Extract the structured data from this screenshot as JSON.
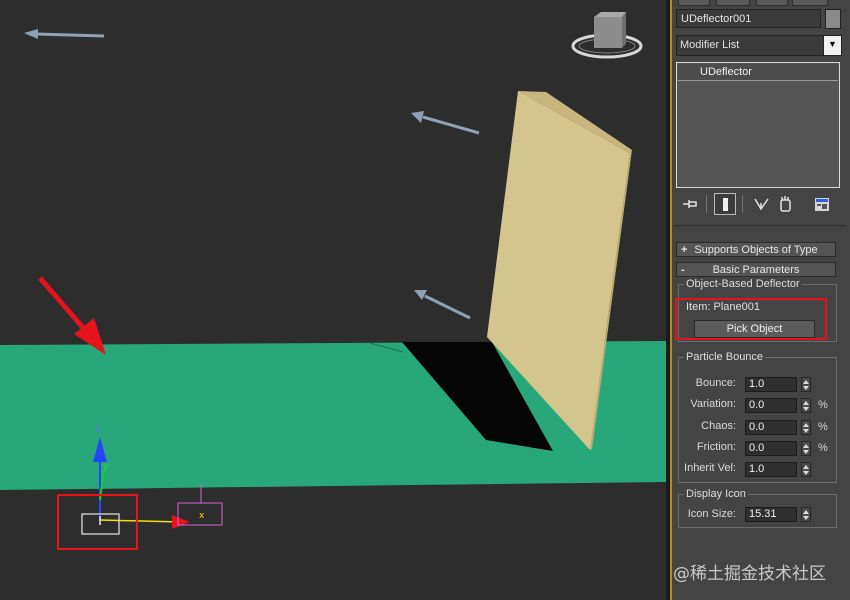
{
  "viewport": {
    "axis_labels": {
      "z": "z",
      "y": "y",
      "x": "x"
    },
    "colors": {
      "background": "#2d2d2d",
      "plane": "#27a77a",
      "box": "#d4c58f",
      "arrow_annotation": "#e4131c",
      "highlight": "#e4131c"
    },
    "objects": [
      "deflector-plane",
      "box-wall",
      "particle-arrow",
      "particle-arrow",
      "particle-arrow",
      "particle-arrow",
      "udeflector-icon",
      "viewcube"
    ]
  },
  "panel": {
    "object_name": "UDeflector001",
    "modifier_list_label": "Modifier List",
    "modifier_list_arrow": "▼",
    "stack_item": "UDeflector",
    "supports_rollout": {
      "sign": "+",
      "title": "Supports Objects of Type"
    },
    "basic_rollout": {
      "sign": "-",
      "title": "Basic Parameters"
    },
    "object_based_group": "Object-Based Deflector",
    "item_label": "Item: Plane001",
    "pick_object_label": "Pick Object",
    "particle_bounce_group": "Particle Bounce",
    "params": [
      {
        "label": "Bounce:",
        "value": "1.0",
        "unit": ""
      },
      {
        "label": "Variation:",
        "value": "0.0",
        "unit": "%"
      },
      {
        "label": "Chaos:",
        "value": "0.0",
        "unit": "%"
      },
      {
        "label": "Friction:",
        "value": "0.0",
        "unit": "%"
      },
      {
        "label": "Inherit Vel:",
        "value": "1.0",
        "unit": ""
      }
    ],
    "display_icon_group": "Display Icon",
    "icon_size_label": "Icon Size:",
    "icon_size_value": "15.31",
    "accent_color": "#b48a1e"
  },
  "watermark": "@稀土掘金技术社区"
}
